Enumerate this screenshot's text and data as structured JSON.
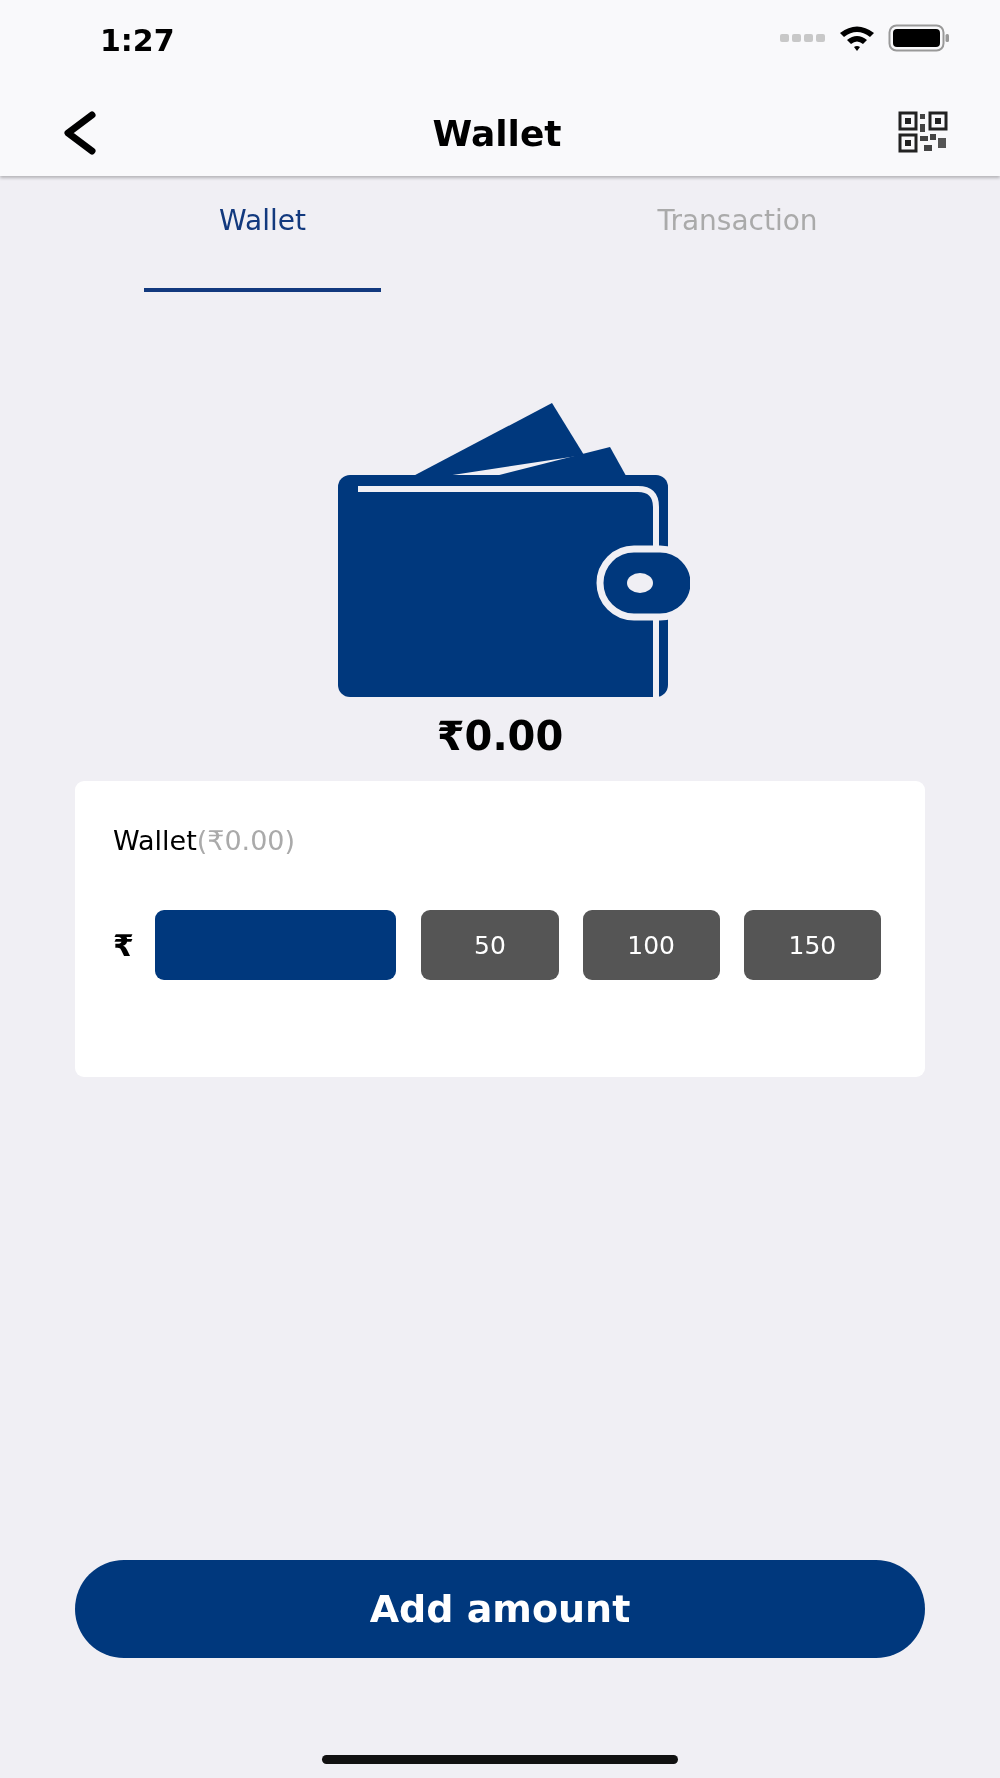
{
  "status_bar": {
    "time": "1:27"
  },
  "nav_bar": {
    "title": "Wallet"
  },
  "tabs": [
    {
      "label": "Wallet",
      "selected": true
    },
    {
      "label": "Transaction",
      "selected": false
    }
  ],
  "balance": "₹0.00",
  "card": {
    "label": "Wallet",
    "label_amount": "(₹0.00)",
    "currency": "₹",
    "quick_amounts": [
      "50",
      "100",
      "150"
    ]
  },
  "primary_button": "Add amount"
}
